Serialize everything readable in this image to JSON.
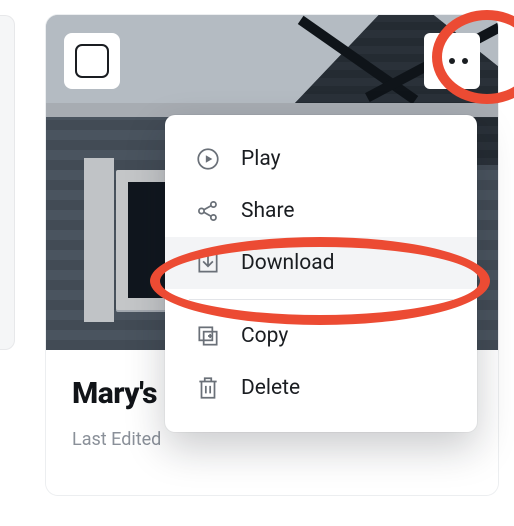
{
  "card": {
    "title": "Mary's",
    "subtitle": "Last Edited"
  },
  "menu": {
    "items": [
      {
        "label": "Play",
        "icon": "play-icon"
      },
      {
        "label": "Share",
        "icon": "share-icon"
      },
      {
        "label": "Download",
        "icon": "download-icon",
        "highlighted": true
      },
      {
        "label": "Copy",
        "icon": "copy-icon"
      },
      {
        "label": "Delete",
        "icon": "delete-icon"
      }
    ]
  },
  "highlight_color": "#ec4b33"
}
